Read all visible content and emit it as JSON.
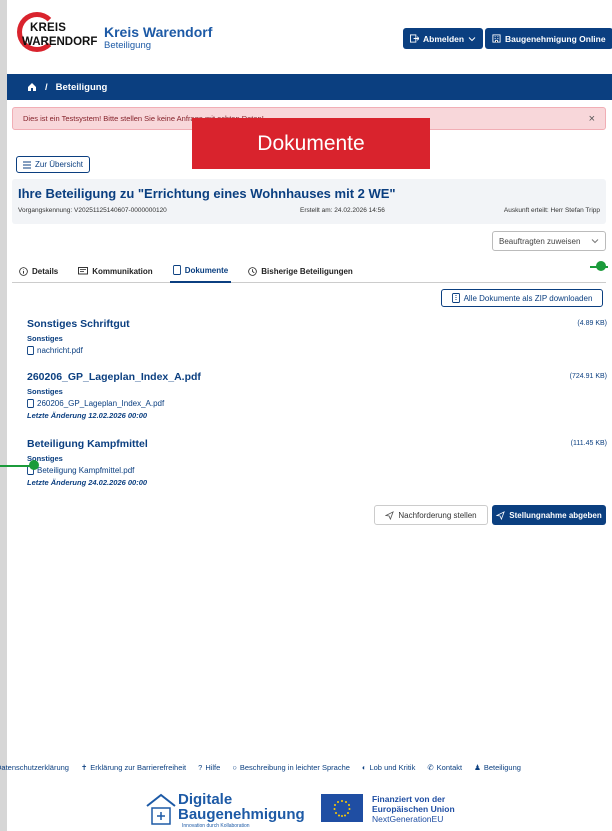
{
  "header": {
    "logo_line1": "KREIS",
    "logo_line2": "WARENDORF",
    "brand_title": "Kreis Warendorf",
    "brand_subtitle": "Beteiligung",
    "logout_label": "Abmelden",
    "baugenehmigung_label": "Baugenehmigung Online"
  },
  "breadcrumb": {
    "current": "Beteiligung"
  },
  "alert": {
    "text": "Dies ist ein Testsystem! Bitte stellen Sie keine Anfrage mit echten Daten!",
    "close": "×"
  },
  "overlay_label": "Dokumente",
  "back_button": "Zur Übersicht",
  "card": {
    "title": "Ihre Beteiligung zu \"Errichtung eines Wohnhauses mit 2 WE\"",
    "vorgang": "Vorgangskennung: V20251125140607-0000000120",
    "erstellt": "Erstellt am: 24.02.2026 14:56",
    "auskunft": "Auskunft erteilt: Herr Stefan Tripp"
  },
  "assign_select": "Beauftragten zuweisen",
  "tabs": [
    {
      "label": "Details"
    },
    {
      "label": "Kommunikation"
    },
    {
      "label": "Dokumente"
    },
    {
      "label": "Bisherige Beteiligungen"
    }
  ],
  "zip_button": "Alle Dokumente als ZIP downloaden",
  "documents": [
    {
      "title": "Sonstiges Schriftgut",
      "size": "(4.89 KB)",
      "category": "Sonstiges",
      "file": "nachricht.pdf",
      "changed": ""
    },
    {
      "title": "260206_GP_Lageplan_Index_A.pdf",
      "size": "(724.91 KB)",
      "category": "Sonstiges",
      "file": "260206_GP_Lageplan_Index_A.pdf",
      "changed": "Letzte Änderung 12.02.2026 00:00"
    },
    {
      "title": "Beteiligung Kampfmittel",
      "size": "(111.45 KB)",
      "category": "Sonstiges",
      "file": "Beteiligung Kampfmittel.pdf",
      "changed": "Letzte Änderung 24.02.2026 00:00"
    }
  ],
  "actions": {
    "nachforderung": "Nachforderung stellen",
    "stellungnahme": "Stellungnahme abgeben"
  },
  "footer": {
    "links": [
      "Datenschutzerklärung",
      "Erklärung zur Barrierefreiheit",
      "Hilfe",
      "Beschreibung in leichter Sprache",
      "Lob und Kritik",
      "Kontakt",
      "Beteiligung"
    ]
  },
  "funding": {
    "digitale_line1": "Digitale",
    "digitale_line2": "Baugenehmigung",
    "digitale_sub": "Innovation durch Kollaboration",
    "eu_line1": "Finanziert von der",
    "eu_line2": "Europäischen Union",
    "eu_line3": "NextGenerationEU"
  },
  "colors": {
    "primary": "#0b3f80",
    "brand_red": "#d9232d",
    "marker_green": "#1b9b3b",
    "alert_bg": "#f8d7da"
  }
}
